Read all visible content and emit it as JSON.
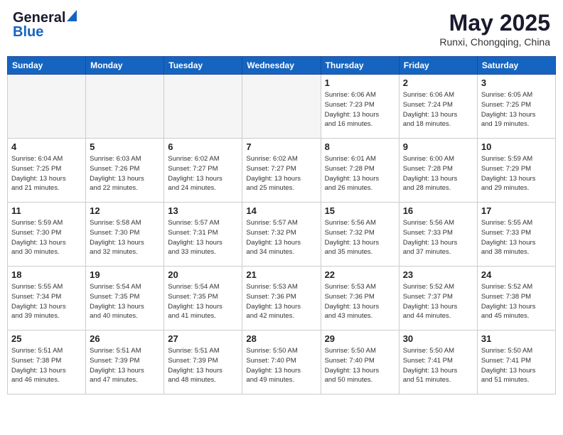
{
  "header": {
    "logo_general": "General",
    "logo_blue": "Blue",
    "month": "May 2025",
    "location": "Runxi, Chongqing, China"
  },
  "weekdays": [
    "Sunday",
    "Monday",
    "Tuesday",
    "Wednesday",
    "Thursday",
    "Friday",
    "Saturday"
  ],
  "weeks": [
    [
      {
        "day": "",
        "info": ""
      },
      {
        "day": "",
        "info": ""
      },
      {
        "day": "",
        "info": ""
      },
      {
        "day": "",
        "info": ""
      },
      {
        "day": "1",
        "info": "Sunrise: 6:06 AM\nSunset: 7:23 PM\nDaylight: 13 hours\nand 16 minutes."
      },
      {
        "day": "2",
        "info": "Sunrise: 6:06 AM\nSunset: 7:24 PM\nDaylight: 13 hours\nand 18 minutes."
      },
      {
        "day": "3",
        "info": "Sunrise: 6:05 AM\nSunset: 7:25 PM\nDaylight: 13 hours\nand 19 minutes."
      }
    ],
    [
      {
        "day": "4",
        "info": "Sunrise: 6:04 AM\nSunset: 7:25 PM\nDaylight: 13 hours\nand 21 minutes."
      },
      {
        "day": "5",
        "info": "Sunrise: 6:03 AM\nSunset: 7:26 PM\nDaylight: 13 hours\nand 22 minutes."
      },
      {
        "day": "6",
        "info": "Sunrise: 6:02 AM\nSunset: 7:27 PM\nDaylight: 13 hours\nand 24 minutes."
      },
      {
        "day": "7",
        "info": "Sunrise: 6:02 AM\nSunset: 7:27 PM\nDaylight: 13 hours\nand 25 minutes."
      },
      {
        "day": "8",
        "info": "Sunrise: 6:01 AM\nSunset: 7:28 PM\nDaylight: 13 hours\nand 26 minutes."
      },
      {
        "day": "9",
        "info": "Sunrise: 6:00 AM\nSunset: 7:28 PM\nDaylight: 13 hours\nand 28 minutes."
      },
      {
        "day": "10",
        "info": "Sunrise: 5:59 AM\nSunset: 7:29 PM\nDaylight: 13 hours\nand 29 minutes."
      }
    ],
    [
      {
        "day": "11",
        "info": "Sunrise: 5:59 AM\nSunset: 7:30 PM\nDaylight: 13 hours\nand 30 minutes."
      },
      {
        "day": "12",
        "info": "Sunrise: 5:58 AM\nSunset: 7:30 PM\nDaylight: 13 hours\nand 32 minutes."
      },
      {
        "day": "13",
        "info": "Sunrise: 5:57 AM\nSunset: 7:31 PM\nDaylight: 13 hours\nand 33 minutes."
      },
      {
        "day": "14",
        "info": "Sunrise: 5:57 AM\nSunset: 7:32 PM\nDaylight: 13 hours\nand 34 minutes."
      },
      {
        "day": "15",
        "info": "Sunrise: 5:56 AM\nSunset: 7:32 PM\nDaylight: 13 hours\nand 35 minutes."
      },
      {
        "day": "16",
        "info": "Sunrise: 5:56 AM\nSunset: 7:33 PM\nDaylight: 13 hours\nand 37 minutes."
      },
      {
        "day": "17",
        "info": "Sunrise: 5:55 AM\nSunset: 7:33 PM\nDaylight: 13 hours\nand 38 minutes."
      }
    ],
    [
      {
        "day": "18",
        "info": "Sunrise: 5:55 AM\nSunset: 7:34 PM\nDaylight: 13 hours\nand 39 minutes."
      },
      {
        "day": "19",
        "info": "Sunrise: 5:54 AM\nSunset: 7:35 PM\nDaylight: 13 hours\nand 40 minutes."
      },
      {
        "day": "20",
        "info": "Sunrise: 5:54 AM\nSunset: 7:35 PM\nDaylight: 13 hours\nand 41 minutes."
      },
      {
        "day": "21",
        "info": "Sunrise: 5:53 AM\nSunset: 7:36 PM\nDaylight: 13 hours\nand 42 minutes."
      },
      {
        "day": "22",
        "info": "Sunrise: 5:53 AM\nSunset: 7:36 PM\nDaylight: 13 hours\nand 43 minutes."
      },
      {
        "day": "23",
        "info": "Sunrise: 5:52 AM\nSunset: 7:37 PM\nDaylight: 13 hours\nand 44 minutes."
      },
      {
        "day": "24",
        "info": "Sunrise: 5:52 AM\nSunset: 7:38 PM\nDaylight: 13 hours\nand 45 minutes."
      }
    ],
    [
      {
        "day": "25",
        "info": "Sunrise: 5:51 AM\nSunset: 7:38 PM\nDaylight: 13 hours\nand 46 minutes."
      },
      {
        "day": "26",
        "info": "Sunrise: 5:51 AM\nSunset: 7:39 PM\nDaylight: 13 hours\nand 47 minutes."
      },
      {
        "day": "27",
        "info": "Sunrise: 5:51 AM\nSunset: 7:39 PM\nDaylight: 13 hours\nand 48 minutes."
      },
      {
        "day": "28",
        "info": "Sunrise: 5:50 AM\nSunset: 7:40 PM\nDaylight: 13 hours\nand 49 minutes."
      },
      {
        "day": "29",
        "info": "Sunrise: 5:50 AM\nSunset: 7:40 PM\nDaylight: 13 hours\nand 50 minutes."
      },
      {
        "day": "30",
        "info": "Sunrise: 5:50 AM\nSunset: 7:41 PM\nDaylight: 13 hours\nand 51 minutes."
      },
      {
        "day": "31",
        "info": "Sunrise: 5:50 AM\nSunset: 7:41 PM\nDaylight: 13 hours\nand 51 minutes."
      }
    ]
  ]
}
